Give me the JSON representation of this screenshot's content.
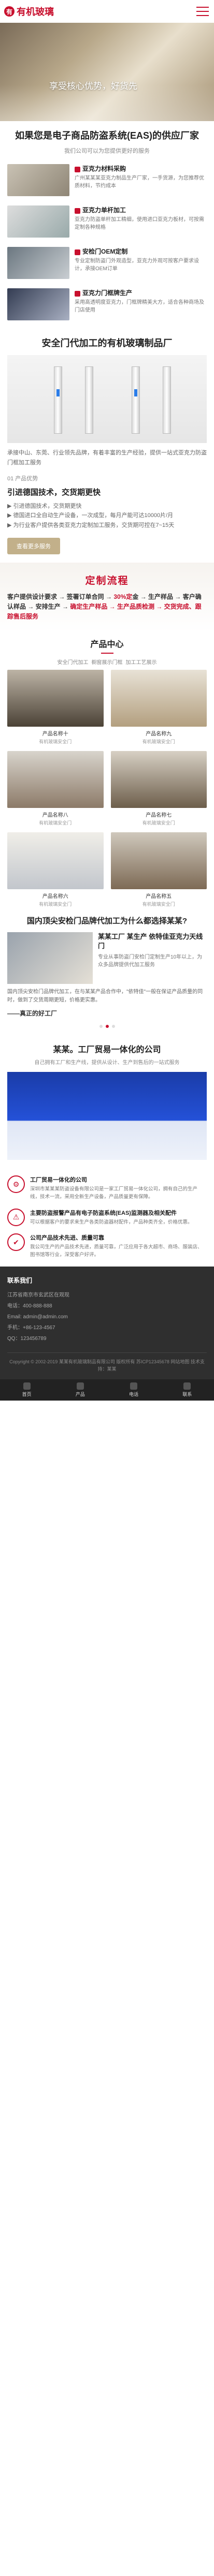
{
  "header": {
    "logo_text": "有机玻璃"
  },
  "hero": {
    "slogan": "享受核心优势，好货先"
  },
  "intro": {
    "title": "如果您是电子商品防盗系统(EAS)的供应厂家",
    "subtitle": "我们公司可以为您提供更好的服务"
  },
  "services": [
    {
      "title": "亚克力材料采购",
      "desc": "广州某某某亚克力制品生产厂家，一手货源，为您推荐优质材料，节约成本"
    },
    {
      "title": "亚克力单杆加工",
      "desc": "亚克力防盗单杆加工精细，使用进口亚克力板材，可按需定制各种规格"
    },
    {
      "title": "安检门OEM定制",
      "desc": "专业定制防盗门外观造型，亚克力外观可按客户要求设计，承接OEM订单"
    },
    {
      "title": "亚克力门框牌生产",
      "desc": "采用高透明度亚克力，门框牌精美大方，适合各种商场及门店使用"
    }
  ],
  "factory_intro": {
    "title": "安全门代加工的有机玻璃制品厂",
    "body": "承接中山、东莞、行业领先品牌，有着丰富的生产经验，提供一站式亚克力防盗门框加工服务",
    "tag": "01 产品优势",
    "headline": "引进德国技术，交货期更快",
    "points": [
      "▶ 引进德国技术，交货期更快",
      "▶ 德国进口全自动生产设备，一次成型，每月产能可达10000片/月",
      "▶ 为行业客户提供各类亚克力定制加工服务，交货期可控在7~15天"
    ],
    "more_button": "查看更多服务"
  },
  "custom": {
    "heading": "定制流程",
    "line1_a": "客户提供设计要求 → 签署订单合同 → ",
    "line1_b": "30%定",
    "line2_a": "金 → 生产样品 → 客户确认样品 → 安排生产 → ",
    "line2_b": "确定生产样品 → 生产品质检测 → 交货完成、跟踪售后服务"
  },
  "products": {
    "heading": "产品中心",
    "tabs": [
      "安全门代加工",
      "橱窗展示门框",
      "加工工艺展示"
    ],
    "items": [
      {
        "name": "产品名称十",
        "cat": "有机玻璃安全门"
      },
      {
        "name": "产品名称九",
        "cat": "有机玻璃安全门"
      },
      {
        "name": "产品名称八",
        "cat": "有机玻璃安全门"
      },
      {
        "name": "产品名称七",
        "cat": "有机玻璃安全门"
      },
      {
        "name": "产品名称六",
        "cat": "有机玻璃安全门"
      },
      {
        "name": "产品名称五",
        "cat": "有机玻璃安全门"
      }
    ]
  },
  "why": {
    "title": "国内顶尖安检门品牌代加工为什么都选择某某?",
    "box_title": "某某工厂 某生产 依特佳亚克力天线门",
    "box_desc": "专业从事防盗门安检门定制生产10年以上，为众多品牌提供代加工服务",
    "body": "国内顶尖安检门品牌代加工，在与某某产品合作中，\"依特佳\"一般在保证产品质量的同时，做到了交货周期更短，价格更实惠。",
    "signoff": "——真正的好工厂"
  },
  "factory": {
    "title": "某某。工厂贸易一体化的公司",
    "subtitle": "自己拥有工厂和生产线，提供从设计、生产到售后的一站式服务"
  },
  "features": [
    {
      "title": "工厂贸易一体化的公司",
      "desc": "深圳市某某某防盗设备有限公司是一家工厂贸易一体化公司，拥有自己的生产线，技术一流，采用全新生产设备，产品质量更有保障。"
    },
    {
      "title": "主要防盗报警产品有电子防盗系统(EAS)监测器及相关配件",
      "desc": "可以根据客户的要求来生产各类防盗器材配件，产品种类齐全，价格优惠。"
    },
    {
      "title": "公司产品技术先进、质量可靠",
      "desc": "我公司生产的产品技术先进，质量可靠，广泛应用于各大超市、商场、服装店、图书馆等行业，深受客户好评。"
    }
  ],
  "footer": {
    "heading": "联系我们",
    "lines": [
      "江苏省南京市玄武区在观现",
      "电话：400-888-888",
      "Email: admin@admin.com",
      "手机：+86-123-4567",
      "QQ：123456789"
    ],
    "copyright": "Copyright © 2002-2019 某某有机玻璃制品有限公司 版权所有 苏ICP12345678 网站地图 技术支持：某某"
  },
  "bottom_nav": [
    "首页",
    "产品",
    "电话",
    "联系"
  ]
}
